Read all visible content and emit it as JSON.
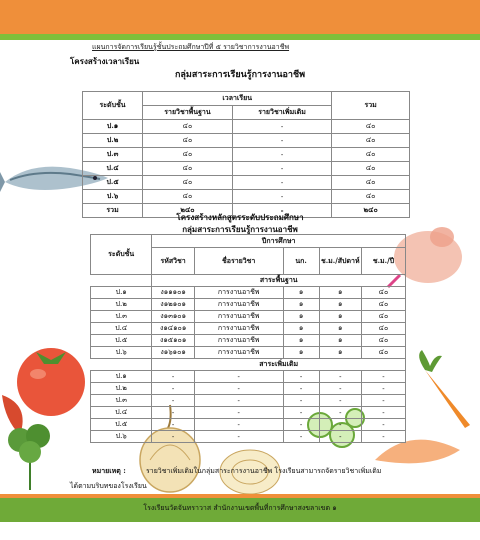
{
  "header": {
    "text": "แผนการจัดการเรียนรู้ชั้นประถมศึกษาปีที่ ๕ รายวิชาการงานอาชีพ"
  },
  "section1": {
    "title": "โครงสร้างเวลาเรียน",
    "subtitle": "กลุ่มสาระการเรียนรู้การงานอาชีพ",
    "table": {
      "col_level": "ระดับชั้น",
      "col_time": "เวลาเรียน",
      "col_basic": "รายวิชาพื้นฐาน",
      "col_extra": "รายวิชาเพิ่มเติม",
      "col_total": "รวม",
      "rows": [
        {
          "level": "ป.๑",
          "basic": "๔๐",
          "extra": "-",
          "total": "๔๐"
        },
        {
          "level": "ป.๒",
          "basic": "๔๐",
          "extra": "-",
          "total": "๔๐"
        },
        {
          "level": "ป.๓",
          "basic": "๔๐",
          "extra": "-",
          "total": "๔๐"
        },
        {
          "level": "ป.๔",
          "basic": "๔๐",
          "extra": "-",
          "total": "๔๐"
        },
        {
          "level": "ป.๕",
          "basic": "๔๐",
          "extra": "-",
          "total": "๔๐"
        },
        {
          "level": "ป.๖",
          "basic": "๔๐",
          "extra": "-",
          "total": "๔๐"
        }
      ],
      "sum": {
        "level": "รวม",
        "basic": "๒๔๐",
        "extra": "-",
        "total": "๒๔๐"
      }
    }
  },
  "section2": {
    "title": "โครงสร้างหลักสูตรระดับประถมศึกษา",
    "subtitle": "กลุ่มสาระการเรียนรู้การงานอาชีพ",
    "table": {
      "col_level": "ระดับชั้น",
      "col_year": "ปีการศึกษา",
      "col_code": "รหัสวิชา",
      "col_name": "ชื่อรายวิชา",
      "col_credit": "นก.",
      "col_week": "ช.ม./สัปดาห์",
      "col_year_hours": "ช.ม./ปี",
      "basic_label": "สาระพื้นฐาน",
      "extra_label": "สาระเพิ่มเติม",
      "basic_rows": [
        {
          "level": "ป.๑",
          "code": "ง๑๑๑๐๑",
          "name": "การงานอาชีพ",
          "credit": "๑",
          "week": "๑",
          "year": "๔๐"
        },
        {
          "level": "ป.๒",
          "code": "ง๑๒๑๐๑",
          "name": "การงานอาชีพ",
          "credit": "๑",
          "week": "๑",
          "year": "๔๐"
        },
        {
          "level": "ป.๓",
          "code": "ง๑๓๑๐๑",
          "name": "การงานอาชีพ",
          "credit": "๑",
          "week": "๑",
          "year": "๔๐"
        },
        {
          "level": "ป.๔",
          "code": "ง๑๔๑๐๑",
          "name": "การงานอาชีพ",
          "credit": "๑",
          "week": "๑",
          "year": "๔๐"
        },
        {
          "level": "ป.๕",
          "code": "ง๑๕๑๐๑",
          "name": "การงานอาชีพ",
          "credit": "๑",
          "week": "๑",
          "year": "๔๐"
        },
        {
          "level": "ป.๖",
          "code": "ง๑๖๑๐๑",
          "name": "การงานอาชีพ",
          "credit": "๑",
          "week": "๑",
          "year": "๔๐"
        }
      ],
      "extra_rows": [
        {
          "level": "ป.๑",
          "code": "-",
          "name": "-",
          "credit": "-",
          "week": "-",
          "year": "-"
        },
        {
          "level": "ป.๒",
          "code": "-",
          "name": "-",
          "credit": "-",
          "week": "-",
          "year": "-"
        },
        {
          "level": "ป.๓",
          "code": "-",
          "name": "-",
          "credit": "-",
          "week": "-",
          "year": "-"
        },
        {
          "level": "ป.๔",
          "code": "-",
          "name": "-",
          "credit": "-",
          "week": "-",
          "year": "-"
        },
        {
          "level": "ป.๕",
          "code": "-",
          "name": "-",
          "credit": "-",
          "week": "-",
          "year": "-"
        },
        {
          "level": "ป.๖",
          "code": "-",
          "name": "-",
          "credit": "-",
          "week": "-",
          "year": "-"
        }
      ]
    }
  },
  "note": {
    "label": "หมายเหตุ :",
    "text": "รายวิชาเพิ่มเติมในกลุ่มสาระการงานอาชีพ โรงเรียนสามารถจัดรายวิชาเพิ่มเติม",
    "continuation": "ได้ตามบริบทของโรงเรียน"
  },
  "footer": {
    "text": "โรงเรียนวัดจันทราวาส สำนักงานเขตพื้นที่การศึกษาสงขลาเขต ๑"
  },
  "colors": {
    "orange": "#ef8f3a",
    "green": "#6faa38"
  }
}
